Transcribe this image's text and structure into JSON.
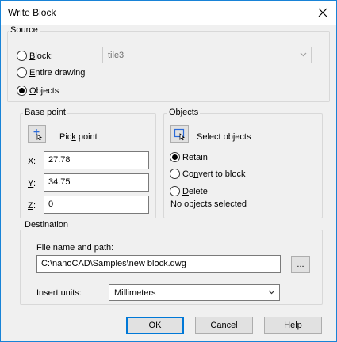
{
  "window": {
    "title": "Write Block"
  },
  "source": {
    "group_title": "Source",
    "block_label_pre": "",
    "block_label_u": "B",
    "block_label_post": "lock:",
    "block_value": "tile3",
    "entire_drawing_label_pre": "",
    "entire_drawing_label_u": "E",
    "entire_drawing_label_post": "ntire drawing",
    "objects_label_pre": "",
    "objects_label_u": "O",
    "objects_label_post": "bjects",
    "selected": "objects"
  },
  "base_point": {
    "group_title": "Base point",
    "pick_label_pre": "Pic",
    "pick_label_u": "k",
    "pick_label_post": " point",
    "x_label": "X",
    "x_value": "27.78",
    "y_label": "Y",
    "y_value": "34.75",
    "z_label": "Z",
    "z_value": "0"
  },
  "objects": {
    "group_title": "Objects",
    "select_label": "Select objects",
    "retain_label_pre": "",
    "retain_label_u": "R",
    "retain_label_post": "etain",
    "convert_label_pre": "Co",
    "convert_label_u": "n",
    "convert_label_post": "vert to block",
    "delete_label_pre": "",
    "delete_label_u": "D",
    "delete_label_post": "elete",
    "selected": "retain",
    "status": "No objects selected"
  },
  "destination": {
    "group_title": "Destination",
    "file_label": "File name and path:",
    "file_value": "C:\\nanoCAD\\Samples\\new block.dwg",
    "browse_label": "...",
    "units_label": "Insert units:",
    "units_value": "Millimeters"
  },
  "buttons": {
    "ok_u": "O",
    "ok_post": "K",
    "cancel_pre": "",
    "cancel_u": "C",
    "cancel_post": "ancel",
    "help_pre": "",
    "help_u": "H",
    "help_post": "elp"
  },
  "icons": {
    "close": "close-icon",
    "pick": "pick-point-icon",
    "select": "select-objects-icon",
    "dropdown": "chevron-down-icon"
  }
}
